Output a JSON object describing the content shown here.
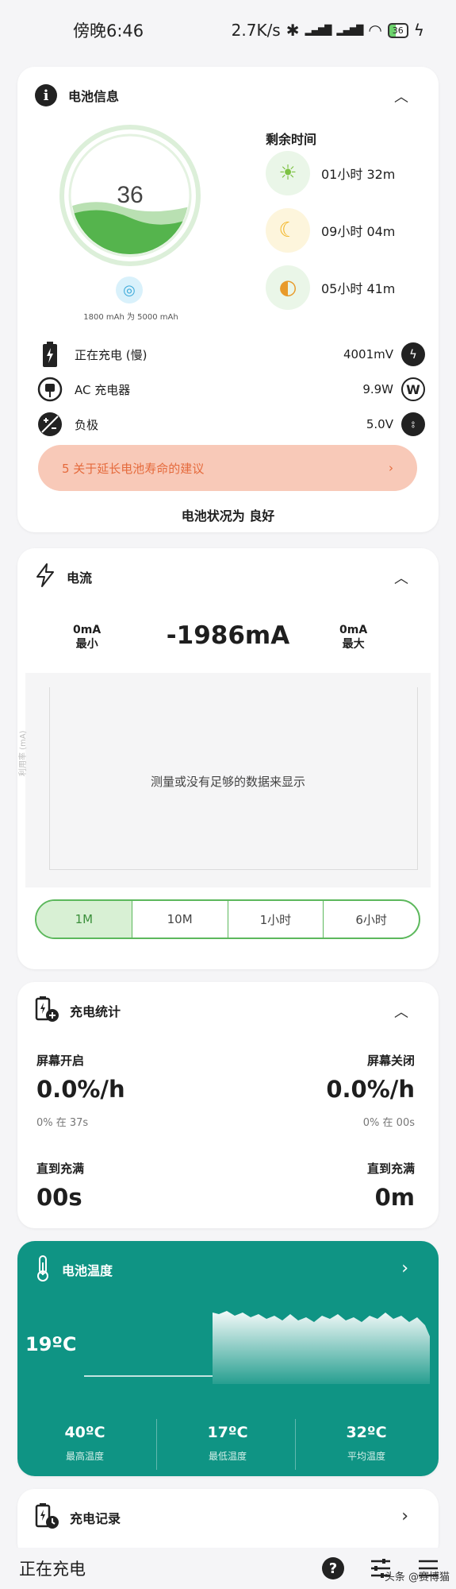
{
  "status_bar": {
    "time": "傍晚6:46",
    "speed": "2.7K/s",
    "battery_level": "36"
  },
  "battery_info": {
    "title": "电池信息",
    "percent": "36",
    "capacity": "1800 mAh 为 5000 mAh",
    "remaining_title": "剩余时间",
    "remaining": [
      {
        "icon": "sun-icon",
        "value": "01小时 32m"
      },
      {
        "icon": "moon-icon",
        "value": "09小时 04m"
      },
      {
        "icon": "sun-moon-icon",
        "value": "05小时 41m"
      }
    ],
    "rows": [
      {
        "label": "正在充电 (慢)",
        "value": "4001mV",
        "left_icon": "battery-charging-icon",
        "right_icon": "bolt-icon"
      },
      {
        "label": "AC 充电器",
        "value": "9.9W",
        "left_icon": "plug-icon",
        "right_icon": "watt-icon"
      },
      {
        "label": "负极",
        "value": "5.0V",
        "left_icon": "polarity-icon",
        "right_icon": "outlet-icon"
      }
    ],
    "tips": "5 关于延长电池寿命的建议",
    "health": "电池状况为 良好"
  },
  "current": {
    "title": "电流",
    "min_value": "0mA",
    "min_label": "最小",
    "max_value": "0mA",
    "max_label": "最大",
    "current_value": "-1986mA",
    "y_axis_label": "利用率 (mA)",
    "empty_message": "测量或没有足够的数据来显示",
    "ranges": [
      "1M",
      "10M",
      "1小时",
      "6小时"
    ]
  },
  "charge_stats": {
    "title": "充电统计",
    "screen_on_label": "屏幕开启",
    "screen_on_rate": "0.0%/h",
    "screen_on_sub": "0% 在 37s",
    "screen_off_label": "屏幕关闭",
    "screen_off_rate": "0.0%/h",
    "screen_off_sub": "0% 在 00s",
    "until_full_label_left": "直到充满",
    "until_full_left": "00s",
    "until_full_label_right": "直到充满",
    "until_full_right": "0m"
  },
  "temperature": {
    "title": "电池温度",
    "current": "19ºC",
    "max_value": "40ºC",
    "max_label": "最高温度",
    "min_value": "17ºC",
    "min_label": "最低温度",
    "avg_value": "32ºC",
    "avg_label": "平均温度"
  },
  "charge_record": {
    "title": "充电记录"
  },
  "bottom_bar": {
    "title": "正在充电"
  },
  "watermark": "头条 @赛博猫",
  "colors": {
    "accent_green": "#5cb85c",
    "teal": "#0f9484",
    "tips_bg": "#f8c9b8",
    "tips_text": "#e56a3c"
  }
}
